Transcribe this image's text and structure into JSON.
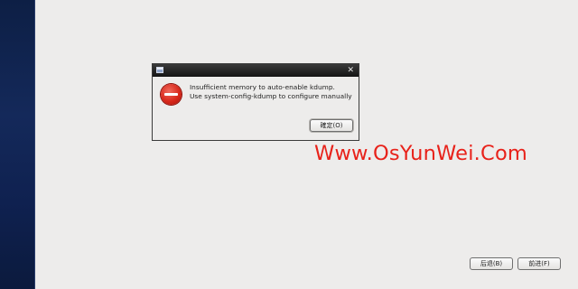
{
  "dialog": {
    "title": "",
    "close_icon": "close-icon",
    "message_line1": "Insufficient memory to auto-enable kdump.",
    "message_line2": "Use system-config-kdump to configure manually",
    "ok_label": "確定(O)",
    "error_icon": "error-icon"
  },
  "navigation": {
    "back_label": "后退(B)",
    "next_label": "前进(F)"
  },
  "watermark": {
    "text": "Www.OsYunWei.Com"
  },
  "colors": {
    "background": "#edeceb",
    "left_band": "#14295a",
    "title_bar": "#141414",
    "error_red": "#d8281b",
    "watermark_red": "#e8221a"
  }
}
